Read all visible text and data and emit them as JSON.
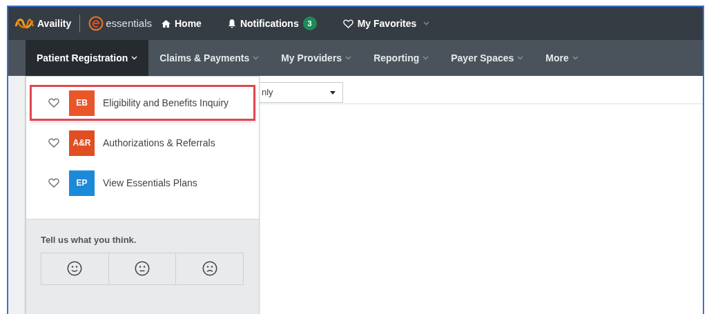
{
  "top_bar": {
    "brand": "Availity",
    "product": "essentials",
    "links": [
      {
        "kind": "home",
        "label": "Home"
      },
      {
        "kind": "notifications",
        "label": "Notifications",
        "badge": "3"
      },
      {
        "kind": "favorites",
        "label": "My Favorites"
      }
    ]
  },
  "nav": [
    {
      "label": "Patient Registration",
      "selected": true
    },
    {
      "label": "Claims & Payments",
      "selected": false
    },
    {
      "label": "My Providers",
      "selected": false
    },
    {
      "label": "Reporting",
      "selected": false
    },
    {
      "label": "Payer Spaces",
      "selected": false
    },
    {
      "label": "More",
      "selected": false
    }
  ],
  "filter_select": {
    "value": "nly"
  },
  "dropdown": {
    "items": [
      {
        "badge": "EB",
        "color": "#e8562a",
        "label": "Eligibility and Benefits Inquiry",
        "highlighted": true
      },
      {
        "badge": "A&R",
        "color": "#e04e22",
        "label": "Authorizations & Referrals",
        "highlighted": false
      },
      {
        "badge": "EP",
        "color": "#1b8ad8",
        "label": "View Essentials Plans",
        "highlighted": false
      }
    ],
    "feedback": {
      "prompt": "Tell us what you think.",
      "faces": [
        {
          "kind": "happy"
        },
        {
          "kind": "neutral"
        },
        {
          "kind": "sad"
        }
      ]
    }
  }
}
